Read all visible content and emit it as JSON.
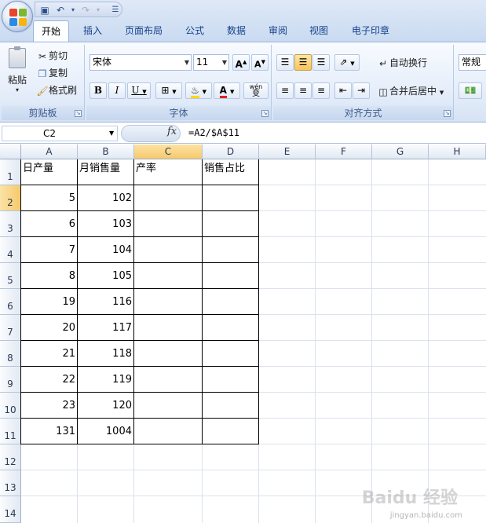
{
  "tabs": [
    "开始",
    "插入",
    "页面布局",
    "公式",
    "数据",
    "审阅",
    "视图",
    "电子印章"
  ],
  "clipboard": {
    "paste": "粘贴",
    "cut": "剪切",
    "copy": "复制",
    "format_painter": "格式刷",
    "label": "剪贴板"
  },
  "font": {
    "name": "宋体",
    "size": "11",
    "label": "字体",
    "bold": "B",
    "italic": "I",
    "underline": "U",
    "font_color": "A",
    "wen": "wén",
    "wen_char": "变",
    "grow": "A",
    "shrink": "A"
  },
  "alignment": {
    "wrap": "自动换行",
    "merge": "合并后居中",
    "label": "对齐方式"
  },
  "number": {
    "format": "常规"
  },
  "formula_bar": {
    "cell_ref": "C2",
    "fx": "fx",
    "formula": "=A2/$A$11"
  },
  "columns": [
    "A",
    "B",
    "C",
    "D",
    "E",
    "F",
    "G",
    "H"
  ],
  "rows": [
    "1",
    "2",
    "3",
    "4",
    "5",
    "6",
    "7",
    "8",
    "9",
    "10",
    "11",
    "12",
    "13",
    "14"
  ],
  "header_row": [
    "日产量",
    "月销售量",
    "产率",
    "销售占比"
  ],
  "data_rows": [
    {
      "a": "5",
      "b": "102"
    },
    {
      "a": "6",
      "b": "103"
    },
    {
      "a": "7",
      "b": "104"
    },
    {
      "a": "8",
      "b": "105"
    },
    {
      "a": "19",
      "b": "116"
    },
    {
      "a": "20",
      "b": "117"
    },
    {
      "a": "21",
      "b": "118"
    },
    {
      "a": "22",
      "b": "119"
    },
    {
      "a": "23",
      "b": "120"
    },
    {
      "a": "131",
      "b": "1004"
    }
  ],
  "watermark": {
    "brand": "Baidu 经验",
    "url": "jingyan.baidu.com"
  },
  "colors": {
    "tab_text": "#15428b",
    "selected_header": "#f7c96b",
    "grid_line": "#dbe2ec"
  }
}
